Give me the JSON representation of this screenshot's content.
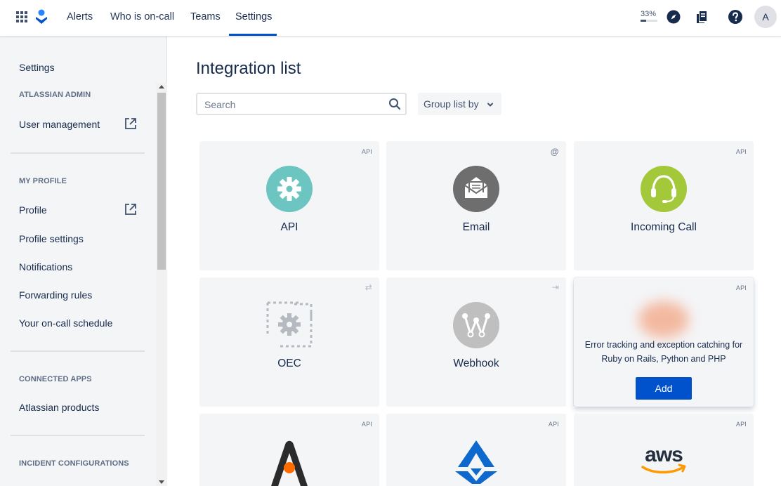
{
  "topnav": {
    "tabs": [
      {
        "label": "Alerts"
      },
      {
        "label": "Who is on-call"
      },
      {
        "label": "Teams"
      },
      {
        "label": "Settings",
        "active": true
      }
    ],
    "progress_text": "33%",
    "progress_value": 0.33,
    "avatar_initial": "A",
    "icons": [
      "app-switcher-icon",
      "opsgenie-logo-icon",
      "compass-icon",
      "docs-icon",
      "help-icon"
    ]
  },
  "sidebar": {
    "settings": "Settings",
    "sections": [
      {
        "heading": "ATLASSIAN ADMIN",
        "items": [
          "User management"
        ]
      },
      {
        "heading": "MY PROFILE",
        "items": [
          "Profile",
          "Profile settings",
          "Notifications",
          "Forwarding rules",
          "Your on-call schedule"
        ]
      },
      {
        "heading": "CONNECTED APPS",
        "items": [
          "Atlassian products"
        ]
      },
      {
        "heading": "INCIDENT CONFIGURATIONS",
        "items": []
      }
    ]
  },
  "main": {
    "title": "Integration list",
    "search_placeholder": "Search",
    "group_label": "Group list by",
    "cards": [
      {
        "name": "API",
        "badge": "API",
        "logo": "gear-icon",
        "color": "#6cc5c1"
      },
      {
        "name": "Email",
        "badge": "@",
        "logo": "envelope-icon",
        "color": "#6e6e6e"
      },
      {
        "name": "Incoming Call",
        "badge": "API",
        "logo": "headset-icon",
        "color": "#a3c93a"
      },
      {
        "name": "OEC",
        "badge": "⇄",
        "logo": "oec-gear-icon",
        "color": "#b5b9c0"
      },
      {
        "name": "Webhook",
        "badge": "⇥",
        "logo": "webhook-icon",
        "color": "#bfbfbf"
      },
      {
        "badge": "API",
        "description": "Error tracking and exception catching for Ruby on Rails, Python and PHP",
        "button": "Add",
        "color": "#f3a583"
      },
      {
        "badge": "API",
        "logo": "a-logo-icon",
        "color": "#2b2b2b"
      },
      {
        "badge": "API",
        "logo": "appdynamics-logo-icon",
        "color": "#0d69cd"
      },
      {
        "badge": "API",
        "logo": "aws-logo-icon",
        "color": "#232f3e"
      }
    ]
  }
}
